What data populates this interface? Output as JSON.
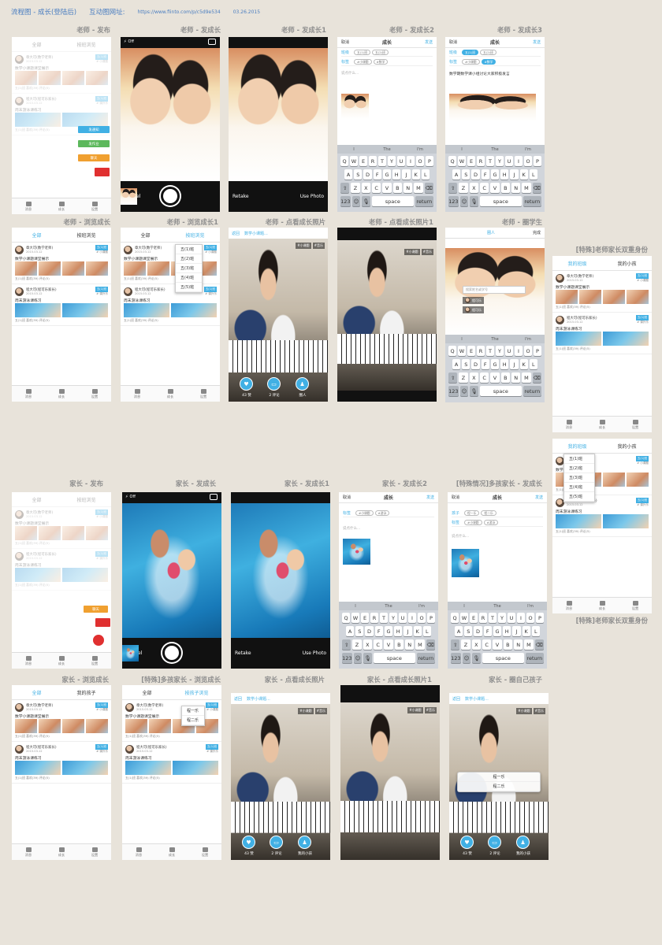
{
  "header": {
    "title": "流程图 - 成长(登陆后)",
    "link_label": "互动图网址:",
    "url": "https://www.fiinto.com/p/c5d9e534",
    "date": "03.26.2015"
  },
  "captions": {
    "t_publish": "老师 - 发布",
    "t_grow": "老师 - 发成长",
    "t_grow1": "老师 - 发成长1",
    "t_grow2": "老师 - 发成长2",
    "t_grow3": "老师 - 发成长3",
    "t_browse": "老师 - 浏览成长",
    "t_browse1": "老师 - 浏览成长1",
    "t_photo": "老师 - 点看成长照片",
    "t_photo1": "老师 - 点看成长照片1",
    "t_circle": "老师 - 圈学生",
    "special1": "[特殊]老师家长双重身份",
    "special2": "[特殊]老师家长双重身份",
    "p_publish": "家长 - 发布",
    "p_grow": "家长 - 发成长",
    "p_grow1": "家长 - 发成长1",
    "p_grow2": "家长 - 发成长2",
    "p_multi": "[特殊情况]多孩家长 - 发成长",
    "p_browse": "家长 - 浏览成长",
    "p_multi_browse": "[特殊]多孩家长 - 浏览成长",
    "p_photo": "家长 - 点看成长照片",
    "p_photo1": "家长 - 点看成长照片1",
    "p_circle": "家长 - 圈自己孩子"
  },
  "labels": {
    "cancel": "Cancel",
    "retake": "Retake",
    "use_photo": "Use Photo",
    "flash": "Off",
    "nav_cancel": "取消",
    "nav_title": "成长",
    "nav_send": "发送",
    "nav_back": "返回",
    "nav_done": "完成",
    "nav_circle": "圈人",
    "row_class": "班级",
    "row_tags": "标签",
    "row_child": "孩子",
    "class_chips": [
      "五(1)班",
      "五(2)班"
    ],
    "class_chips3": [
      "五(1)班",
      "五(2)班"
    ],
    "tag_chips": [
      "#小课题",
      "#数学"
    ],
    "tag_chips2": [
      "#小课题",
      "#游泳"
    ],
    "child_chips": [
      "程一乐",
      "程二乐"
    ],
    "placeholder": "说点什么...",
    "typed_text": "数学期数学课小组讨论大家积极发言",
    "keys1": [
      "Q",
      "W",
      "E",
      "R",
      "T",
      "Y",
      "U",
      "I",
      "O",
      "P"
    ],
    "keys2": [
      "A",
      "S",
      "D",
      "F",
      "G",
      "H",
      "J",
      "K",
      "L"
    ],
    "keys3": [
      "Z",
      "X",
      "C",
      "V",
      "B",
      "N",
      "M"
    ],
    "suggest": [
      "I",
      "The",
      "I'm"
    ],
    "space": "space",
    "ret": "return",
    "num": "123",
    "tab_all": "全部",
    "tab_browse": "按班浏览",
    "tab_my_class": "我的班级",
    "tab_my_kid": "我的小孩",
    "tab_my_child": "我的孩子",
    "tab_browse_kid": "按孩子浏览",
    "btn_notice": "发通知",
    "btn_homework": "发作业",
    "btn_chat": "聊天",
    "btn_grow": "发成长",
    "post1_name": "章大可(数学老师)",
    "post1_date": "2015.03.12",
    "post1_class": "五(1)班",
    "post1_tag": "# 小课题",
    "post1_text": "数学小课题课堂展示",
    "post1_meta": "五(1)班  喜欢(39)  评论(5)",
    "post2_name": "程大可(程可乐家长)",
    "post2_date": "2015.03.12",
    "post2_class": "五(1)班",
    "post2_tag": "# 课外乐",
    "post2_text": "周末游泳课练习",
    "post2_meta": "五(1)班  喜欢(39)  评论(5)",
    "class_menu": [
      "五(1)班",
      "五(2)班",
      "五(3)班",
      "五(4)班",
      "五(5)班"
    ],
    "kid_menu": [
      "程一乐",
      "程二乐"
    ],
    "photo_title": "数学小课题...",
    "tag_a": "#小课题",
    "tag_b": "#音乐",
    "likes": "43 赞",
    "comments": "2 评论",
    "circle": "圈人",
    "my_kid_btn": "我的小孩",
    "tabbar": [
      "消息",
      "成长",
      "设置"
    ],
    "search_ph": "搜索姓名或学号",
    "pick1": "程可乐",
    "pick2": "程可乐",
    "circle_menu": [
      "程一乐",
      "程二乐"
    ]
  }
}
